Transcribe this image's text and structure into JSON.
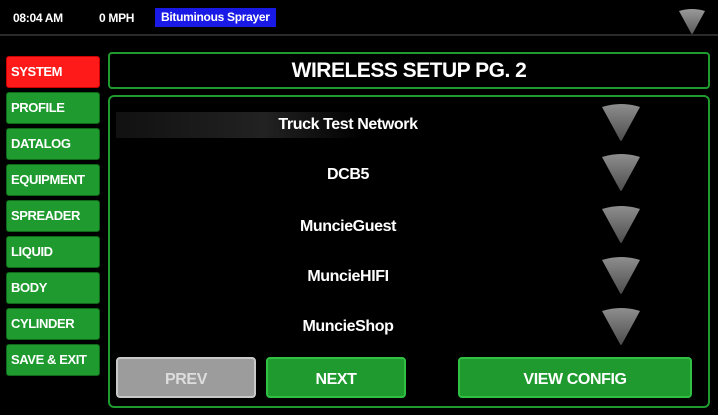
{
  "status": {
    "time": "08:04 AM",
    "speed": "0 MPH",
    "mode": "Bituminous Sprayer",
    "signal_icon": "wifi-signal-icon"
  },
  "menu": {
    "items": [
      {
        "label": "SYSTEM",
        "active": true
      },
      {
        "label": "PROFILE",
        "active": false
      },
      {
        "label": "DATALOG",
        "active": false
      },
      {
        "label": "EQUIPMENT",
        "active": false
      },
      {
        "label": "SPREADER",
        "active": false
      },
      {
        "label": "LIQUID",
        "active": false
      },
      {
        "label": "BODY",
        "active": false
      },
      {
        "label": "CYLINDER",
        "active": false
      },
      {
        "label": "SAVE & EXIT",
        "active": false
      }
    ]
  },
  "title": "WIRELESS SETUP PG. 2",
  "networks": [
    {
      "name": "Truck Test Network",
      "icon": "wifi-signal-icon"
    },
    {
      "name": "DCB5",
      "icon": "wifi-signal-icon"
    },
    {
      "name": "MuncieGuest",
      "icon": "wifi-signal-icon"
    },
    {
      "name": "MuncieHIFI",
      "icon": "wifi-signal-icon"
    },
    {
      "name": "MuncieShop",
      "icon": "wifi-signal-icon"
    }
  ],
  "buttons": {
    "prev": "PREV",
    "next": "NEXT",
    "view_config": "VIEW CONFIG"
  },
  "colors": {
    "accent_green": "#1f9a2f",
    "active_red": "#ff1a1a",
    "mode_blue": "#1a1ae6",
    "disabled_gray": "#9c9c9c"
  }
}
